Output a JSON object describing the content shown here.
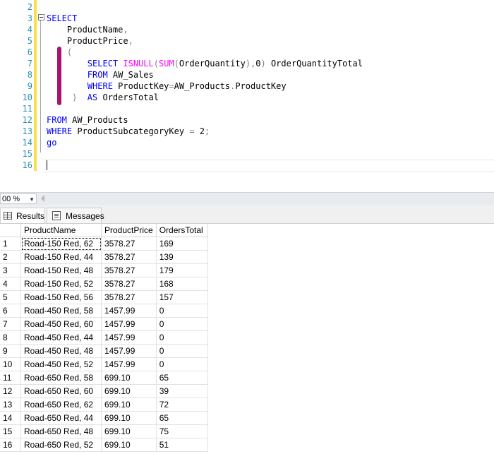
{
  "editor": {
    "line_numbers": [
      "2",
      "3",
      "4",
      "5",
      "6",
      "7",
      "8",
      "9",
      "10",
      "11",
      "12",
      "13",
      "14",
      "15",
      "16"
    ],
    "lines": [
      [],
      [
        {
          "t": "SELECT",
          "c": "kw"
        }
      ],
      [
        {
          "t": "    ProductName",
          "c": "id"
        },
        {
          "t": ",",
          "c": "op"
        }
      ],
      [
        {
          "t": "    ProductPrice",
          "c": "id"
        },
        {
          "t": ",",
          "c": "op"
        }
      ],
      [
        {
          "t": "    (",
          "c": "op"
        }
      ],
      [
        {
          "t": "        SELECT ",
          "c": "kw"
        },
        {
          "t": "ISNULL",
          "c": "fn"
        },
        {
          "t": "(",
          "c": "op"
        },
        {
          "t": "SUM",
          "c": "fn"
        },
        {
          "t": "(",
          "c": "op"
        },
        {
          "t": "OrderQuantity",
          "c": "id"
        },
        {
          "t": "),",
          "c": "op"
        },
        {
          "t": "0",
          "c": "id"
        },
        {
          "t": ")",
          "c": "op"
        },
        {
          "t": " OrderQuantityTotal",
          "c": "id"
        }
      ],
      [
        {
          "t": "        FROM ",
          "c": "kw"
        },
        {
          "t": "AW_Sales",
          "c": "id"
        }
      ],
      [
        {
          "t": "        WHERE ",
          "c": "kw"
        },
        {
          "t": "ProductKey",
          "c": "id"
        },
        {
          "t": "=",
          "c": "op"
        },
        {
          "t": "AW_Products",
          "c": "id"
        },
        {
          "t": ".",
          "c": "op"
        },
        {
          "t": "ProductKey",
          "c": "id"
        }
      ],
      [
        {
          "t": "     )  ",
          "c": "op"
        },
        {
          "t": "AS ",
          "c": "kw"
        },
        {
          "t": "OrdersTotal",
          "c": "id"
        }
      ],
      [],
      [
        {
          "t": "FROM ",
          "c": "kw"
        },
        {
          "t": "AW_Products",
          "c": "id"
        }
      ],
      [
        {
          "t": "WHERE ",
          "c": "kw"
        },
        {
          "t": "ProductSubcategoryKey ",
          "c": "id"
        },
        {
          "t": "=",
          "c": "op"
        },
        {
          "t": " 2",
          "c": "id"
        },
        {
          "t": ";",
          "c": "op"
        }
      ],
      [
        {
          "t": "go",
          "c": "kw"
        }
      ],
      [],
      []
    ]
  },
  "status": {
    "zoom": "00 %"
  },
  "tabs": {
    "results": "Results",
    "messages": "Messages"
  },
  "results": {
    "columns": [
      "ProductName",
      "ProductPrice",
      "OrdersTotal"
    ],
    "rows": [
      [
        "1",
        "Road-150 Red, 62",
        "3578.27",
        "169"
      ],
      [
        "2",
        "Road-150 Red, 44",
        "3578.27",
        "139"
      ],
      [
        "3",
        "Road-150 Red, 48",
        "3578.27",
        "179"
      ],
      [
        "4",
        "Road-150 Red, 52",
        "3578.27",
        "168"
      ],
      [
        "5",
        "Road-150 Red, 56",
        "3578.27",
        "157"
      ],
      [
        "6",
        "Road-450 Red, 58",
        "1457.99",
        "0"
      ],
      [
        "7",
        "Road-450 Red, 60",
        "1457.99",
        "0"
      ],
      [
        "8",
        "Road-450 Red, 44",
        "1457.99",
        "0"
      ],
      [
        "9",
        "Road-450 Red, 48",
        "1457.99",
        "0"
      ],
      [
        "10",
        "Road-450 Red, 52",
        "1457.99",
        "0"
      ],
      [
        "11",
        "Road-650 Red, 58",
        "699.10",
        "65"
      ],
      [
        "12",
        "Road-650 Red, 60",
        "699.10",
        "39"
      ],
      [
        "13",
        "Road-650 Red, 62",
        "699.10",
        "72"
      ],
      [
        "14",
        "Road-650 Red, 44",
        "699.10",
        "65"
      ],
      [
        "15",
        "Road-650 Red, 48",
        "699.10",
        "75"
      ],
      [
        "16",
        "Road-650 Red, 52",
        "699.10",
        "51"
      ]
    ]
  }
}
